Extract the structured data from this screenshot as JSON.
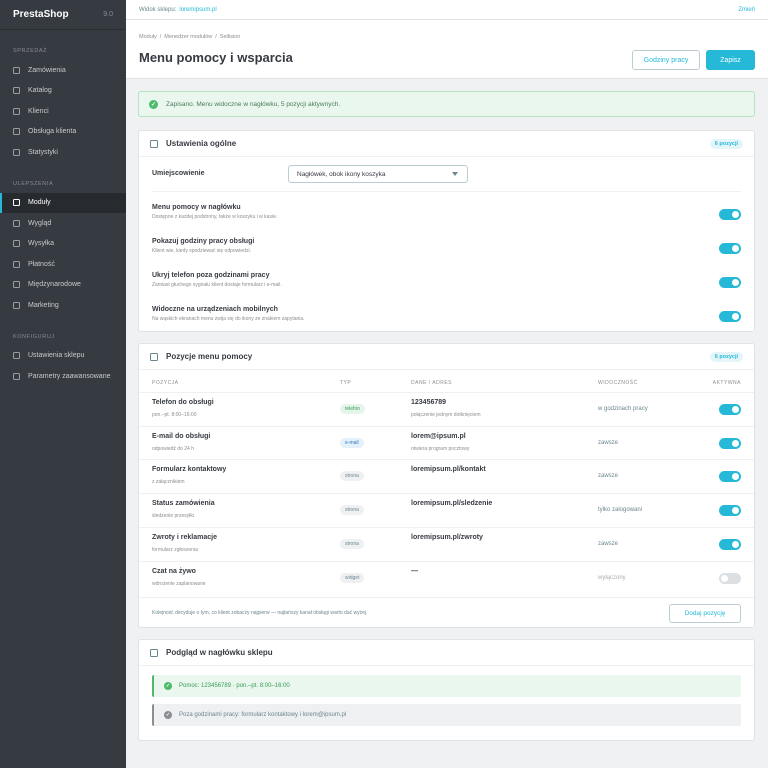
{
  "sidebar": {
    "brand": "PrestaShop",
    "version": "9.0",
    "sections": [
      {
        "title": "SPRZEDAŻ",
        "items": [
          "Zamówienia",
          "Katalog",
          "Klienci",
          "Obsługa klienta",
          "Statystyki"
        ]
      },
      {
        "title": "ULEPSZENIA",
        "items": [
          "Moduły",
          "Wygląd",
          "Wysyłka",
          "Płatność",
          "Międzynarodowe",
          "Marketing"
        ]
      },
      {
        "title": "KONFIGURUJ",
        "items": [
          "Ustawienia sklepu",
          "Parametry zaawansowane"
        ]
      }
    ],
    "active_item": "Moduły"
  },
  "topbar": {
    "shop_label": "Widok sklepu:",
    "shop_url": "loremipsum.pl",
    "change_label": "Zmień"
  },
  "header": {
    "breadcrumb": [
      "Moduły",
      "Menedżer modułów",
      "Sellision"
    ],
    "title": "Menu pomocy i wsparcia",
    "btn_hours": "Godziny pracy",
    "btn_save": "Zapisz"
  },
  "alert": {
    "icon": "check-icon",
    "text": "Zapisano. Menu widoczne w nagłówku, 5 pozycji aktywnych."
  },
  "general": {
    "title": "Ustawienia ogólne",
    "count": "6 pozycji",
    "placement_label": "Umiejscowienie",
    "placement_value": "Nagłówek, obok ikony koszyka",
    "settings": [
      {
        "label": "Menu pomocy w nagłówku",
        "hint": "Dostępne z każdej podstrony, także w koszyku i w kasie.",
        "on": true
      },
      {
        "label": "Pokazuj godziny pracy obsługi",
        "hint": "Klient wie, kiedy spodziewać się odpowiedzi.",
        "on": true
      },
      {
        "label": "Ukryj telefon poza godzinami pracy",
        "hint": "Zamiast głuchego sygnału klient dostaje formularz i e-mail.",
        "on": true
      },
      {
        "label": "Widoczne na urządzeniach mobilnych",
        "hint": "Na wąskich ekranach menu zwija się do ikony ze znakiem zapytania.",
        "on": true
      }
    ]
  },
  "items_card": {
    "title": "Pozycje menu pomocy",
    "count": "6 pozycji",
    "columns": {
      "name": "POZYCJA",
      "type": "TYP",
      "data": "DANE / ADRES",
      "visibility": "WIDOCZNOŚĆ",
      "active": "AKTYWNA"
    },
    "rows": [
      {
        "name": "Telefon do obsługi",
        "sub": "pon.–pt. 8:00–16:00",
        "type": "telefon",
        "type_style": "phone",
        "value": "123456789",
        "value_sub": "połączenie jednym dotknięciem",
        "visibility": "w godzinach pracy",
        "active": true
      },
      {
        "name": "E-mail do obsługi",
        "sub": "odpowiedź do 24 h",
        "type": "e-mail",
        "type_style": "mail",
        "value": "lorem@ipsum.pl",
        "value_sub": "otwiera program pocztowy",
        "visibility": "zawsze",
        "active": true
      },
      {
        "name": "Formularz kontaktowy",
        "sub": "z załącznikiem",
        "type": "strona",
        "type_style": "page",
        "value": "loremipsum.pl/kontakt",
        "value_sub": "",
        "visibility": "zawsze",
        "active": true
      },
      {
        "name": "Status zamówienia",
        "sub": "śledzenie przesyłki",
        "type": "strona",
        "type_style": "page",
        "value": "loremipsum.pl/sledzenie",
        "value_sub": "",
        "visibility": "tylko zalogowani",
        "active": true
      },
      {
        "name": "Zwroty i reklamacje",
        "sub": "formularz zgłoszenia",
        "type": "strona",
        "type_style": "page",
        "value": "loremipsum.pl/zwroty",
        "value_sub": "",
        "visibility": "zawsze",
        "active": true
      },
      {
        "name": "Czat na żywo",
        "sub": "wdrożenie zaplanowane",
        "type": "widget",
        "type_style": "page",
        "value": "—",
        "value_sub": "",
        "visibility": "wyłączony",
        "active": false
      }
    ],
    "footer_note": "Kolejność decyduje o tym, co klient zobaczy najpierw — najtańszy kanał obsługi warto dać wyżej.",
    "add_button": "Dodaj pozycję"
  },
  "preview_card": {
    "title": "Podgląd w nagłówku sklepu",
    "lines": [
      {
        "text": "Pomoc: 123456789 · pon.–pt. 8:00–16:00",
        "state": "on"
      },
      {
        "text": "Poza godzinami pracy: formularz kontaktowy i lorem@ipsum.pl",
        "state": "off"
      }
    ]
  },
  "colors": {
    "accent": "#25b9d7",
    "sidebar": "#363a41",
    "success": "#4cbb6c"
  }
}
